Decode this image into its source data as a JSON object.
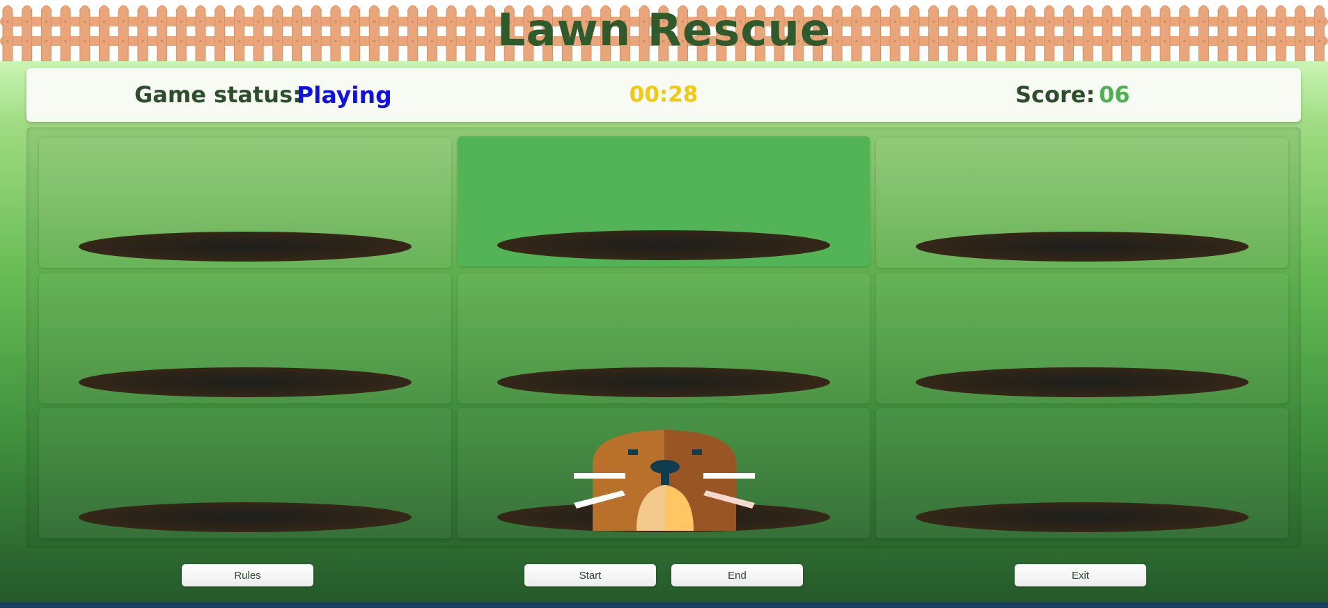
{
  "game": {
    "title": "Lawn Rescue"
  },
  "status_bar": {
    "status_label": "Game status:",
    "status_value": "Playing",
    "timer": "00:28",
    "score_label": "Score:",
    "score_value": "06"
  },
  "board": {
    "rows": 3,
    "columns": 3,
    "highlighted_cell": "row 1, column 2",
    "mole_cell": "row 3, column 2"
  },
  "buttons": {
    "rules": "Rules",
    "start": "Start",
    "end": "End",
    "exit": "Exit"
  },
  "colors": {
    "title": "#2e5a2c",
    "status_value": "#1010e8",
    "timer": "#f2c90f",
    "score_value": "#4caf50",
    "fence": "#e9a67a"
  }
}
